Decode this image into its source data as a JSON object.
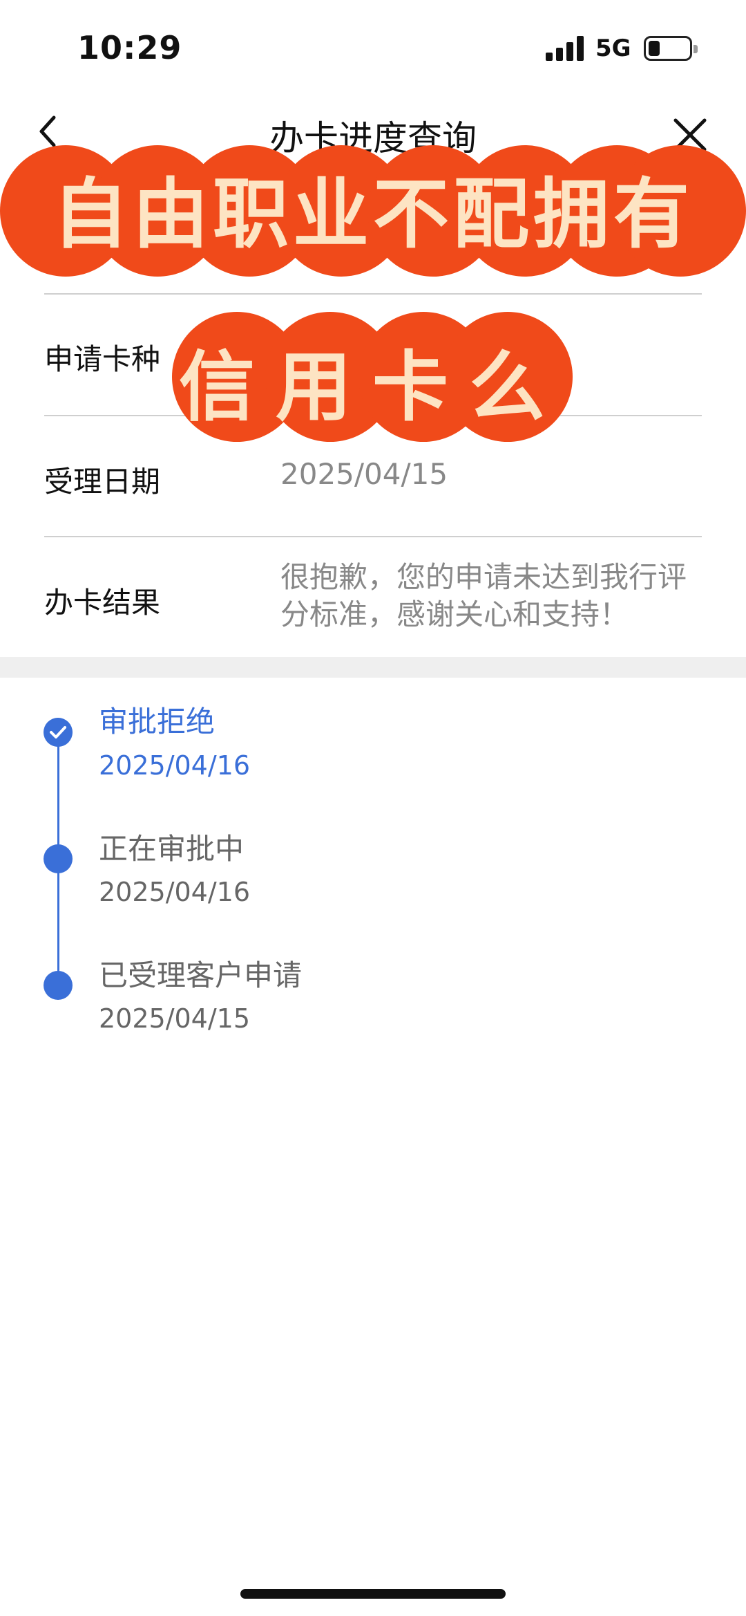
{
  "status_bar": {
    "time": "10:29",
    "network": "5G"
  },
  "nav": {
    "title": "办卡进度查询"
  },
  "overlay": {
    "line1": "自由职业不配拥有",
    "line2": "信用卡么"
  },
  "info": {
    "rows": [
      {
        "label": "申请卡种",
        "value": ""
      },
      {
        "label": "受理日期",
        "value": "2025/04/15"
      },
      {
        "label": "办卡结果",
        "value_line1": "很抱歉，您的申请未达到我行评",
        "value_line2": "分标准，感谢关心和支持！"
      }
    ]
  },
  "timeline": [
    {
      "title": "审批拒绝",
      "date": "2025/04/16",
      "status": "current"
    },
    {
      "title": "正在审批中",
      "date": "2025/04/16",
      "status": "done"
    },
    {
      "title": "已受理客户申请",
      "date": "2025/04/15",
      "status": "done"
    }
  ],
  "colors": {
    "accent": "#3a6fd8",
    "banner": "#f04a1a",
    "banner_text": "#fde4c3"
  }
}
